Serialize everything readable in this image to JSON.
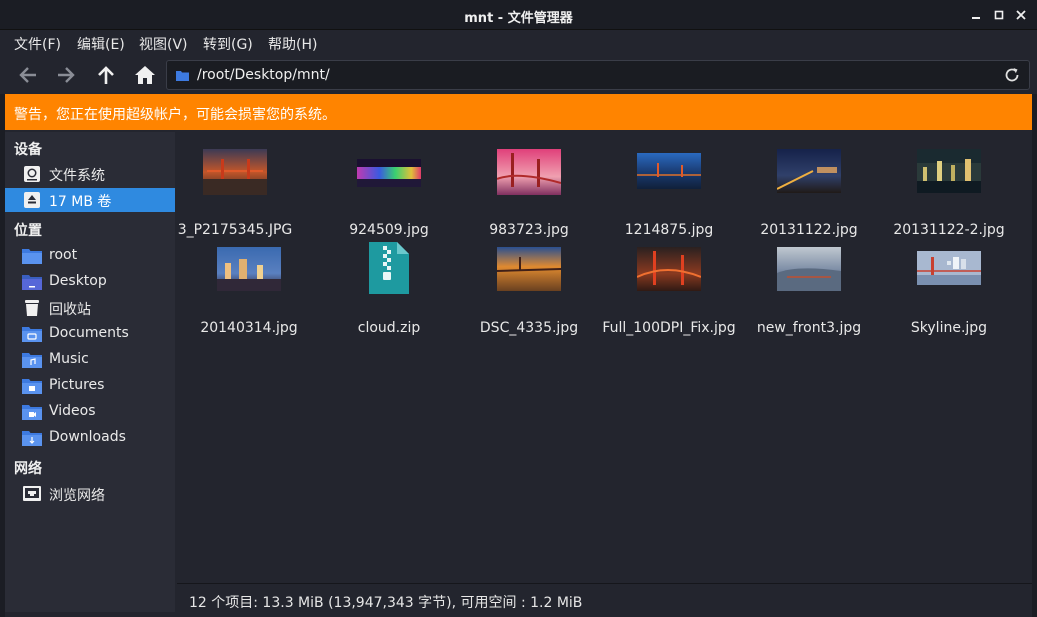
{
  "window": {
    "title": "mnt - 文件管理器"
  },
  "menu": [
    {
      "label": "文件(F)"
    },
    {
      "label": "编辑(E)"
    },
    {
      "label": "视图(V)"
    },
    {
      "label": "转到(G)"
    },
    {
      "label": "帮助(H)"
    }
  ],
  "toolbar": {
    "path": "/root/Desktop/mnt/"
  },
  "warning": {
    "text": "警告，您正在使用超级帐户，可能会损害您的系统。"
  },
  "sidebar": {
    "devices_header": "设备",
    "devices": [
      {
        "label": "文件系统",
        "icon": "harddisk-icon"
      },
      {
        "label": "17 MB 卷",
        "icon": "eject-icon"
      }
    ],
    "places_header": "位置",
    "places": [
      {
        "label": "root",
        "icon": "home-folder-icon"
      },
      {
        "label": "Desktop",
        "icon": "desktop-folder-icon"
      },
      {
        "label": "回收站",
        "icon": "trash-icon"
      },
      {
        "label": "Documents",
        "icon": "documents-folder-icon"
      },
      {
        "label": "Music",
        "icon": "music-folder-icon"
      },
      {
        "label": "Pictures",
        "icon": "pictures-folder-icon"
      },
      {
        "label": "Videos",
        "icon": "videos-folder-icon"
      },
      {
        "label": "Downloads",
        "icon": "downloads-folder-icon"
      }
    ],
    "network_header": "网络",
    "network": [
      {
        "label": "浏览网络",
        "icon": "network-icon"
      }
    ]
  },
  "files": [
    {
      "name": "3_P2175345.JPG"
    },
    {
      "name": "924509.jpg"
    },
    {
      "name": "983723.jpg"
    },
    {
      "name": "1214875.jpg"
    },
    {
      "name": "20131122.jpg"
    },
    {
      "name": "20131122-2.jpg"
    },
    {
      "name": "20140314.jpg"
    },
    {
      "name": "cloud.zip"
    },
    {
      "name": "DSC_4335.jpg"
    },
    {
      "name": "Full_100DPI_Fix.jpg"
    },
    {
      "name": "new_front3.jpg"
    },
    {
      "name": "Skyline.jpg"
    }
  ],
  "status": {
    "text": "12 个项目: 13.3 MiB (13,947,343 字节), 可用空间 : 1.2 MiB"
  },
  "colors": {
    "accent": "#2f8ae0",
    "warning": "#ff8400",
    "background": "#23252e",
    "sidebar": "#2a2c36"
  }
}
